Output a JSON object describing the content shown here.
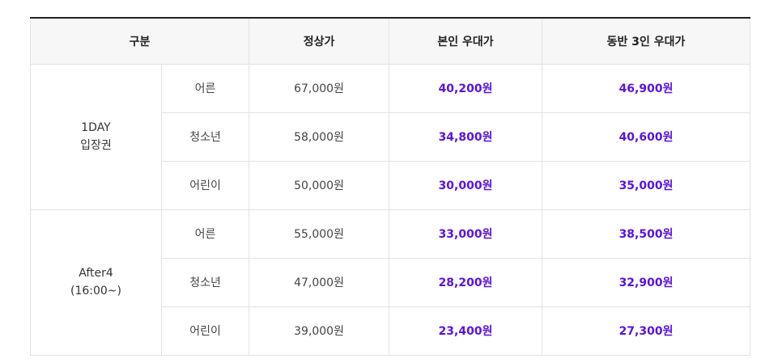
{
  "headers": [
    "구분",
    "정상가",
    "본인 우대가",
    "동반 3인 우대가"
  ],
  "groups": [
    {
      "label_line1": "1DAY",
      "label_line2": "입장권",
      "rows": [
        {
          "type": "어른",
          "regular": "67,000원",
          "self": "40,200원",
          "companion": "46,900원"
        },
        {
          "type": "청소년",
          "regular": "58,000원",
          "self": "34,800원",
          "companion": "40,600원"
        },
        {
          "type": "어린이",
          "regular": "50,000원",
          "self": "30,000원",
          "companion": "35,000원"
        }
      ]
    },
    {
      "label_line1": "After4",
      "label_line2": "(16:00~)",
      "rows": [
        {
          "type": "어른",
          "regular": "55,000원",
          "self": "33,000원",
          "companion": "38,500원"
        },
        {
          "type": "청소년",
          "regular": "47,000원",
          "self": "28,200원",
          "companion": "32,900원"
        },
        {
          "type": "어린이",
          "regular": "39,000원",
          "self": "23,400원",
          "companion": "27,300원"
        }
      ]
    }
  ],
  "colors": {
    "discount": "#5a14e0",
    "header_bg": "#f7f7f7",
    "border": "#e2e2e2"
  }
}
